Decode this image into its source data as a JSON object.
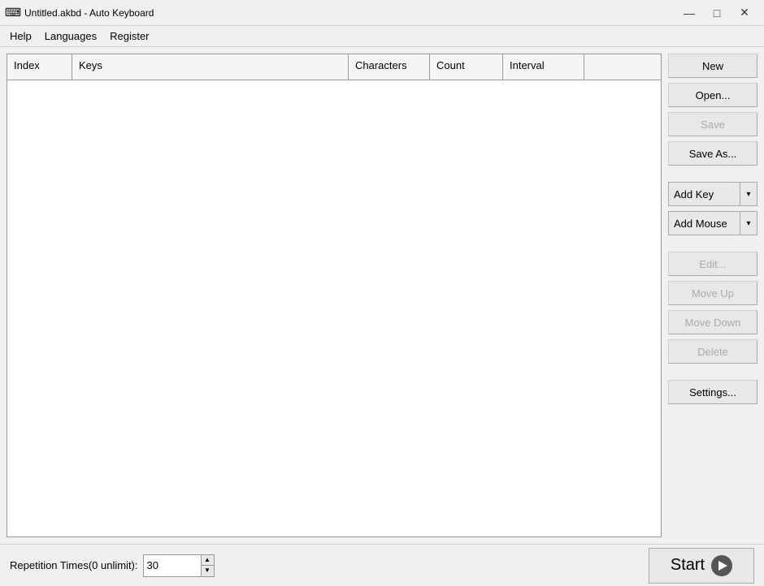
{
  "window": {
    "title": "Untitled.akbd - Auto Keyboard",
    "icon": "⌨"
  },
  "title_controls": {
    "minimize": "—",
    "maximize": "□",
    "close": "✕"
  },
  "menu": {
    "items": [
      {
        "label": "Help"
      },
      {
        "label": "Languages"
      },
      {
        "label": "Register"
      }
    ]
  },
  "table": {
    "columns": [
      {
        "label": "Index",
        "key": "index"
      },
      {
        "label": "Keys",
        "key": "keys"
      },
      {
        "label": "Characters",
        "key": "characters"
      },
      {
        "label": "Count",
        "key": "count"
      },
      {
        "label": "Interval",
        "key": "interval"
      }
    ],
    "rows": []
  },
  "sidebar": {
    "new_label": "New",
    "open_label": "Open...",
    "save_label": "Save",
    "save_as_label": "Save As...",
    "add_key_label": "Add Key",
    "add_mouse_label": "Add Mouse",
    "edit_label": "Edit...",
    "move_up_label": "Move Up",
    "move_down_label": "Move Down",
    "delete_label": "Delete",
    "settings_label": "Settings..."
  },
  "bottom": {
    "repetition_label": "Repetition Times(0 unlimit):",
    "repetition_value": "30",
    "start_label": "Start"
  }
}
